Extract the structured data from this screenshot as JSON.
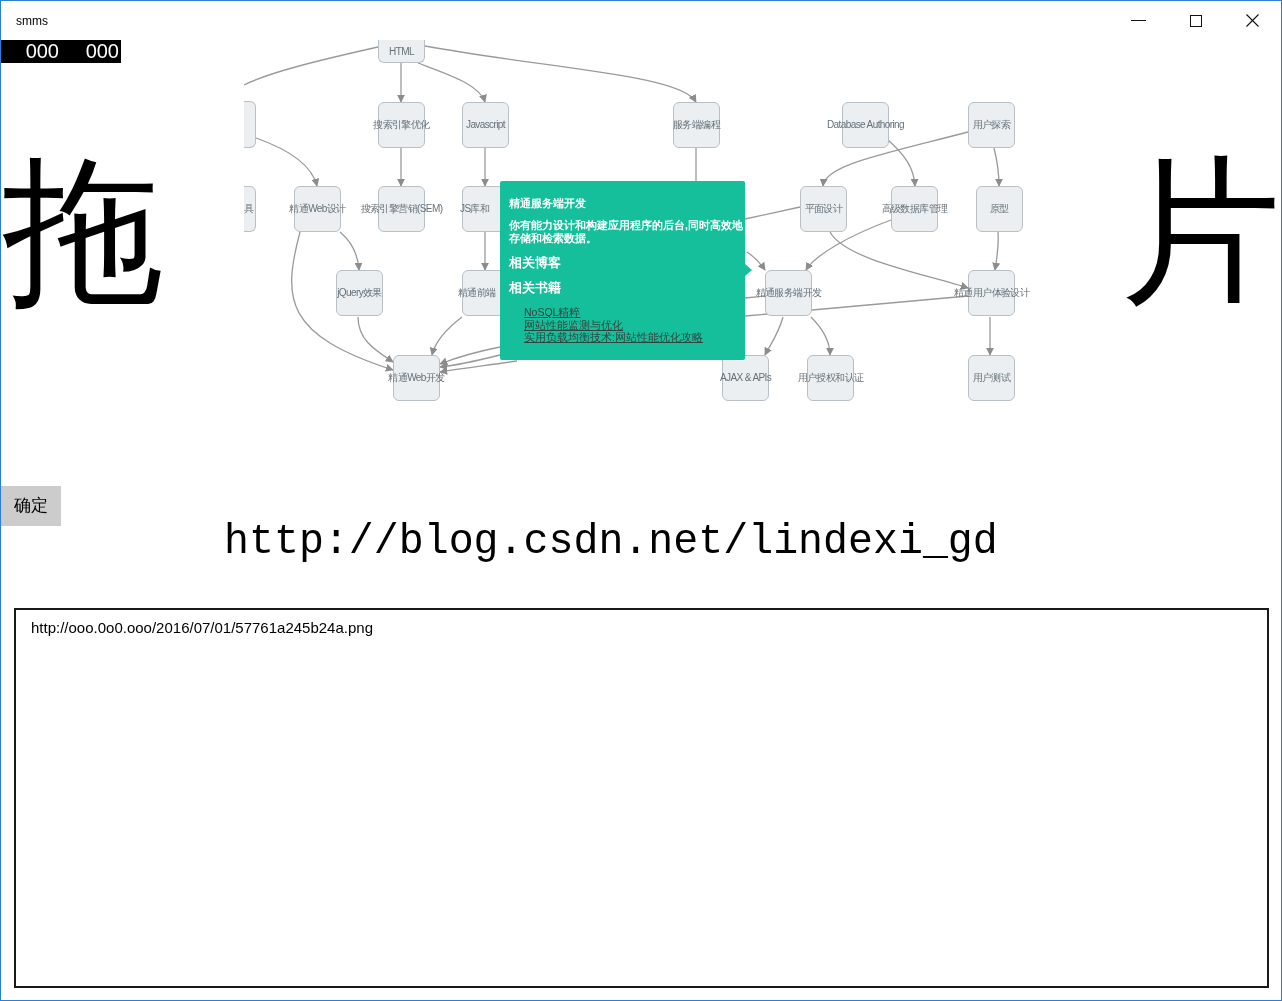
{
  "window": {
    "title": "smms"
  },
  "counter": [
    "000",
    "000"
  ],
  "drop_hint": {
    "left": "拖",
    "right": "片"
  },
  "diagram": {
    "nodes": [
      {
        "label": "HTML"
      },
      {
        "label": "搜索引擎优化"
      },
      {
        "label": "Javascript"
      },
      {
        "label": "服务端编程"
      },
      {
        "label": "Database Authoring"
      },
      {
        "label": "用户探索"
      },
      {
        "label": "具"
      },
      {
        "label": "精通Web设计"
      },
      {
        "label": "搜索引擎营销(SEM)"
      },
      {
        "label": "JS库和"
      },
      {
        "label": "平面设计"
      },
      {
        "label": "高级数据库管理"
      },
      {
        "label": "原型"
      },
      {
        "label": "jQuery效果"
      },
      {
        "label": "精通前端"
      },
      {
        "label": "精通服务端开发"
      },
      {
        "label": "精通用户体验设计"
      },
      {
        "label": "精通Web开发"
      },
      {
        "label": "AJAX & APIs"
      },
      {
        "label": "用户授权和认证"
      },
      {
        "label": "用户测试"
      }
    ],
    "tooltip": {
      "title": "精通服务端开发",
      "description": "你有能力设计和构建应用程序的后台,同时高效地存储和检索数据。",
      "related_blogs": {
        "heading": "相关博客"
      },
      "related_books": {
        "heading": "相关书籍",
        "links": [
          "NoSQL精粹",
          "网站性能监测与优化",
          "实用负载均衡技术:网站性能优化攻略"
        ]
      }
    }
  },
  "confirm_button": {
    "label": "确定"
  },
  "blog_url": "http://blog.csdn.net/lindexi_gd",
  "url_box": {
    "value": "http://ooo.0o0.ooo/2016/07/01/57761a245b24a.png"
  }
}
